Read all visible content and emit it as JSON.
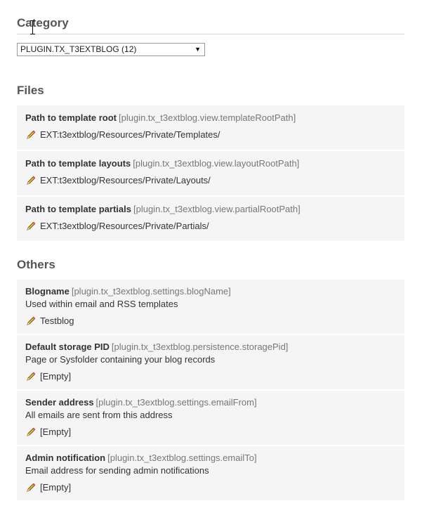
{
  "category": {
    "title": "Category",
    "select_value": "PLUGIN.TX_T3EXTBLOG (12)"
  },
  "files": {
    "title": "Files",
    "items": [
      {
        "name": "Path to template root",
        "key": "[plugin.tx_t3extblog.view.templateRootPath]",
        "value": "EXT:t3extblog/Resources/Private/Templates/"
      },
      {
        "name": "Path to template layouts",
        "key": "[plugin.tx_t3extblog.view.layoutRootPath]",
        "value": "EXT:t3extblog/Resources/Private/Layouts/"
      },
      {
        "name": "Path to template partials",
        "key": "[plugin.tx_t3extblog.view.partialRootPath]",
        "value": "EXT:t3extblog/Resources/Private/Partials/"
      }
    ]
  },
  "others": {
    "title": "Others",
    "items": [
      {
        "name": "Blogname",
        "key": "[plugin.tx_t3extblog.settings.blogName]",
        "desc": "Used within email and RSS templates",
        "value": "Testblog"
      },
      {
        "name": "Default storage PID",
        "key": "[plugin.tx_t3extblog.persistence.storagePid]",
        "desc": "Page or Sysfolder containing your blog records",
        "value": "[Empty]"
      },
      {
        "name": "Sender address",
        "key": "[plugin.tx_t3extblog.settings.emailFrom]",
        "desc": "All emails are sent from this address",
        "value": "[Empty]"
      },
      {
        "name": "Admin notification",
        "key": "[plugin.tx_t3extblog.settings.emailTo]",
        "desc": "Email address for sending admin notifications",
        "value": "[Empty]"
      }
    ]
  },
  "icons": {
    "edit": "pencil-icon",
    "dropdown": "triangle-down-icon",
    "cursor": "text-cursor-icon"
  }
}
